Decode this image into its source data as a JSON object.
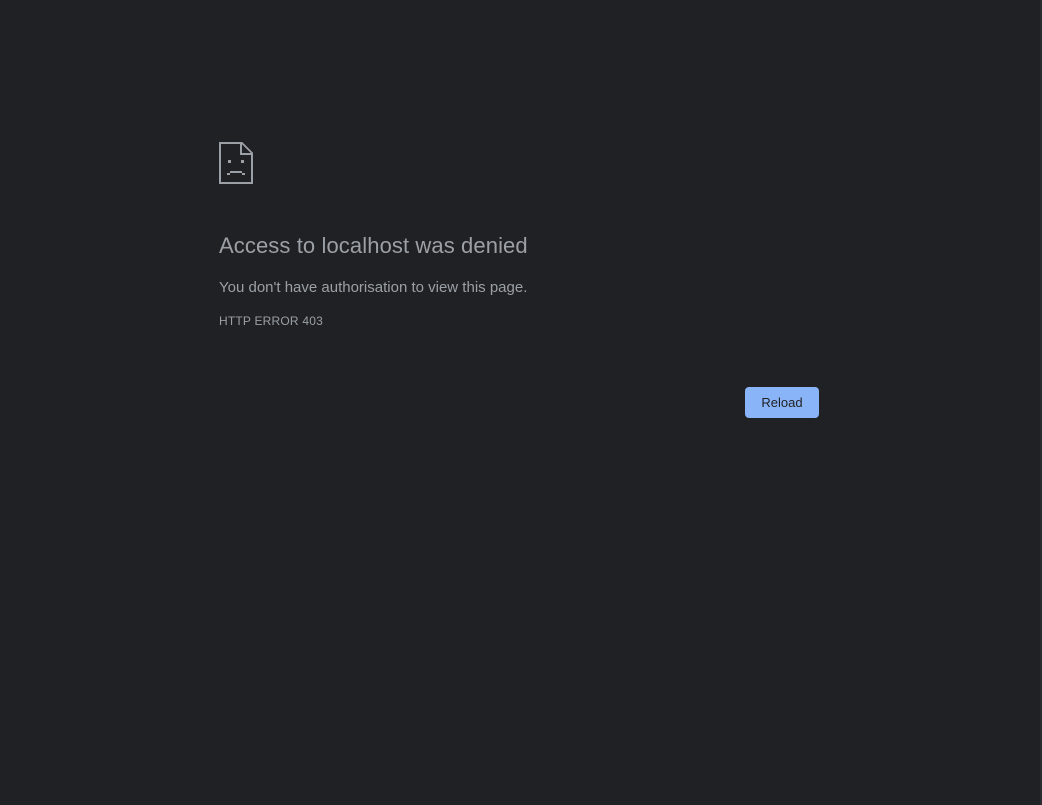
{
  "error": {
    "icon": "sad-document-icon",
    "title": "Access to localhost was denied",
    "summary": "You don't have authorisation to view this page.",
    "code": "HTTP ERROR 403"
  },
  "actions": {
    "reload_label": "Reload"
  },
  "colors": {
    "background": "#202124",
    "text": "#9aa0a6",
    "button": "#8ab4f8",
    "button_text": "#202124"
  }
}
